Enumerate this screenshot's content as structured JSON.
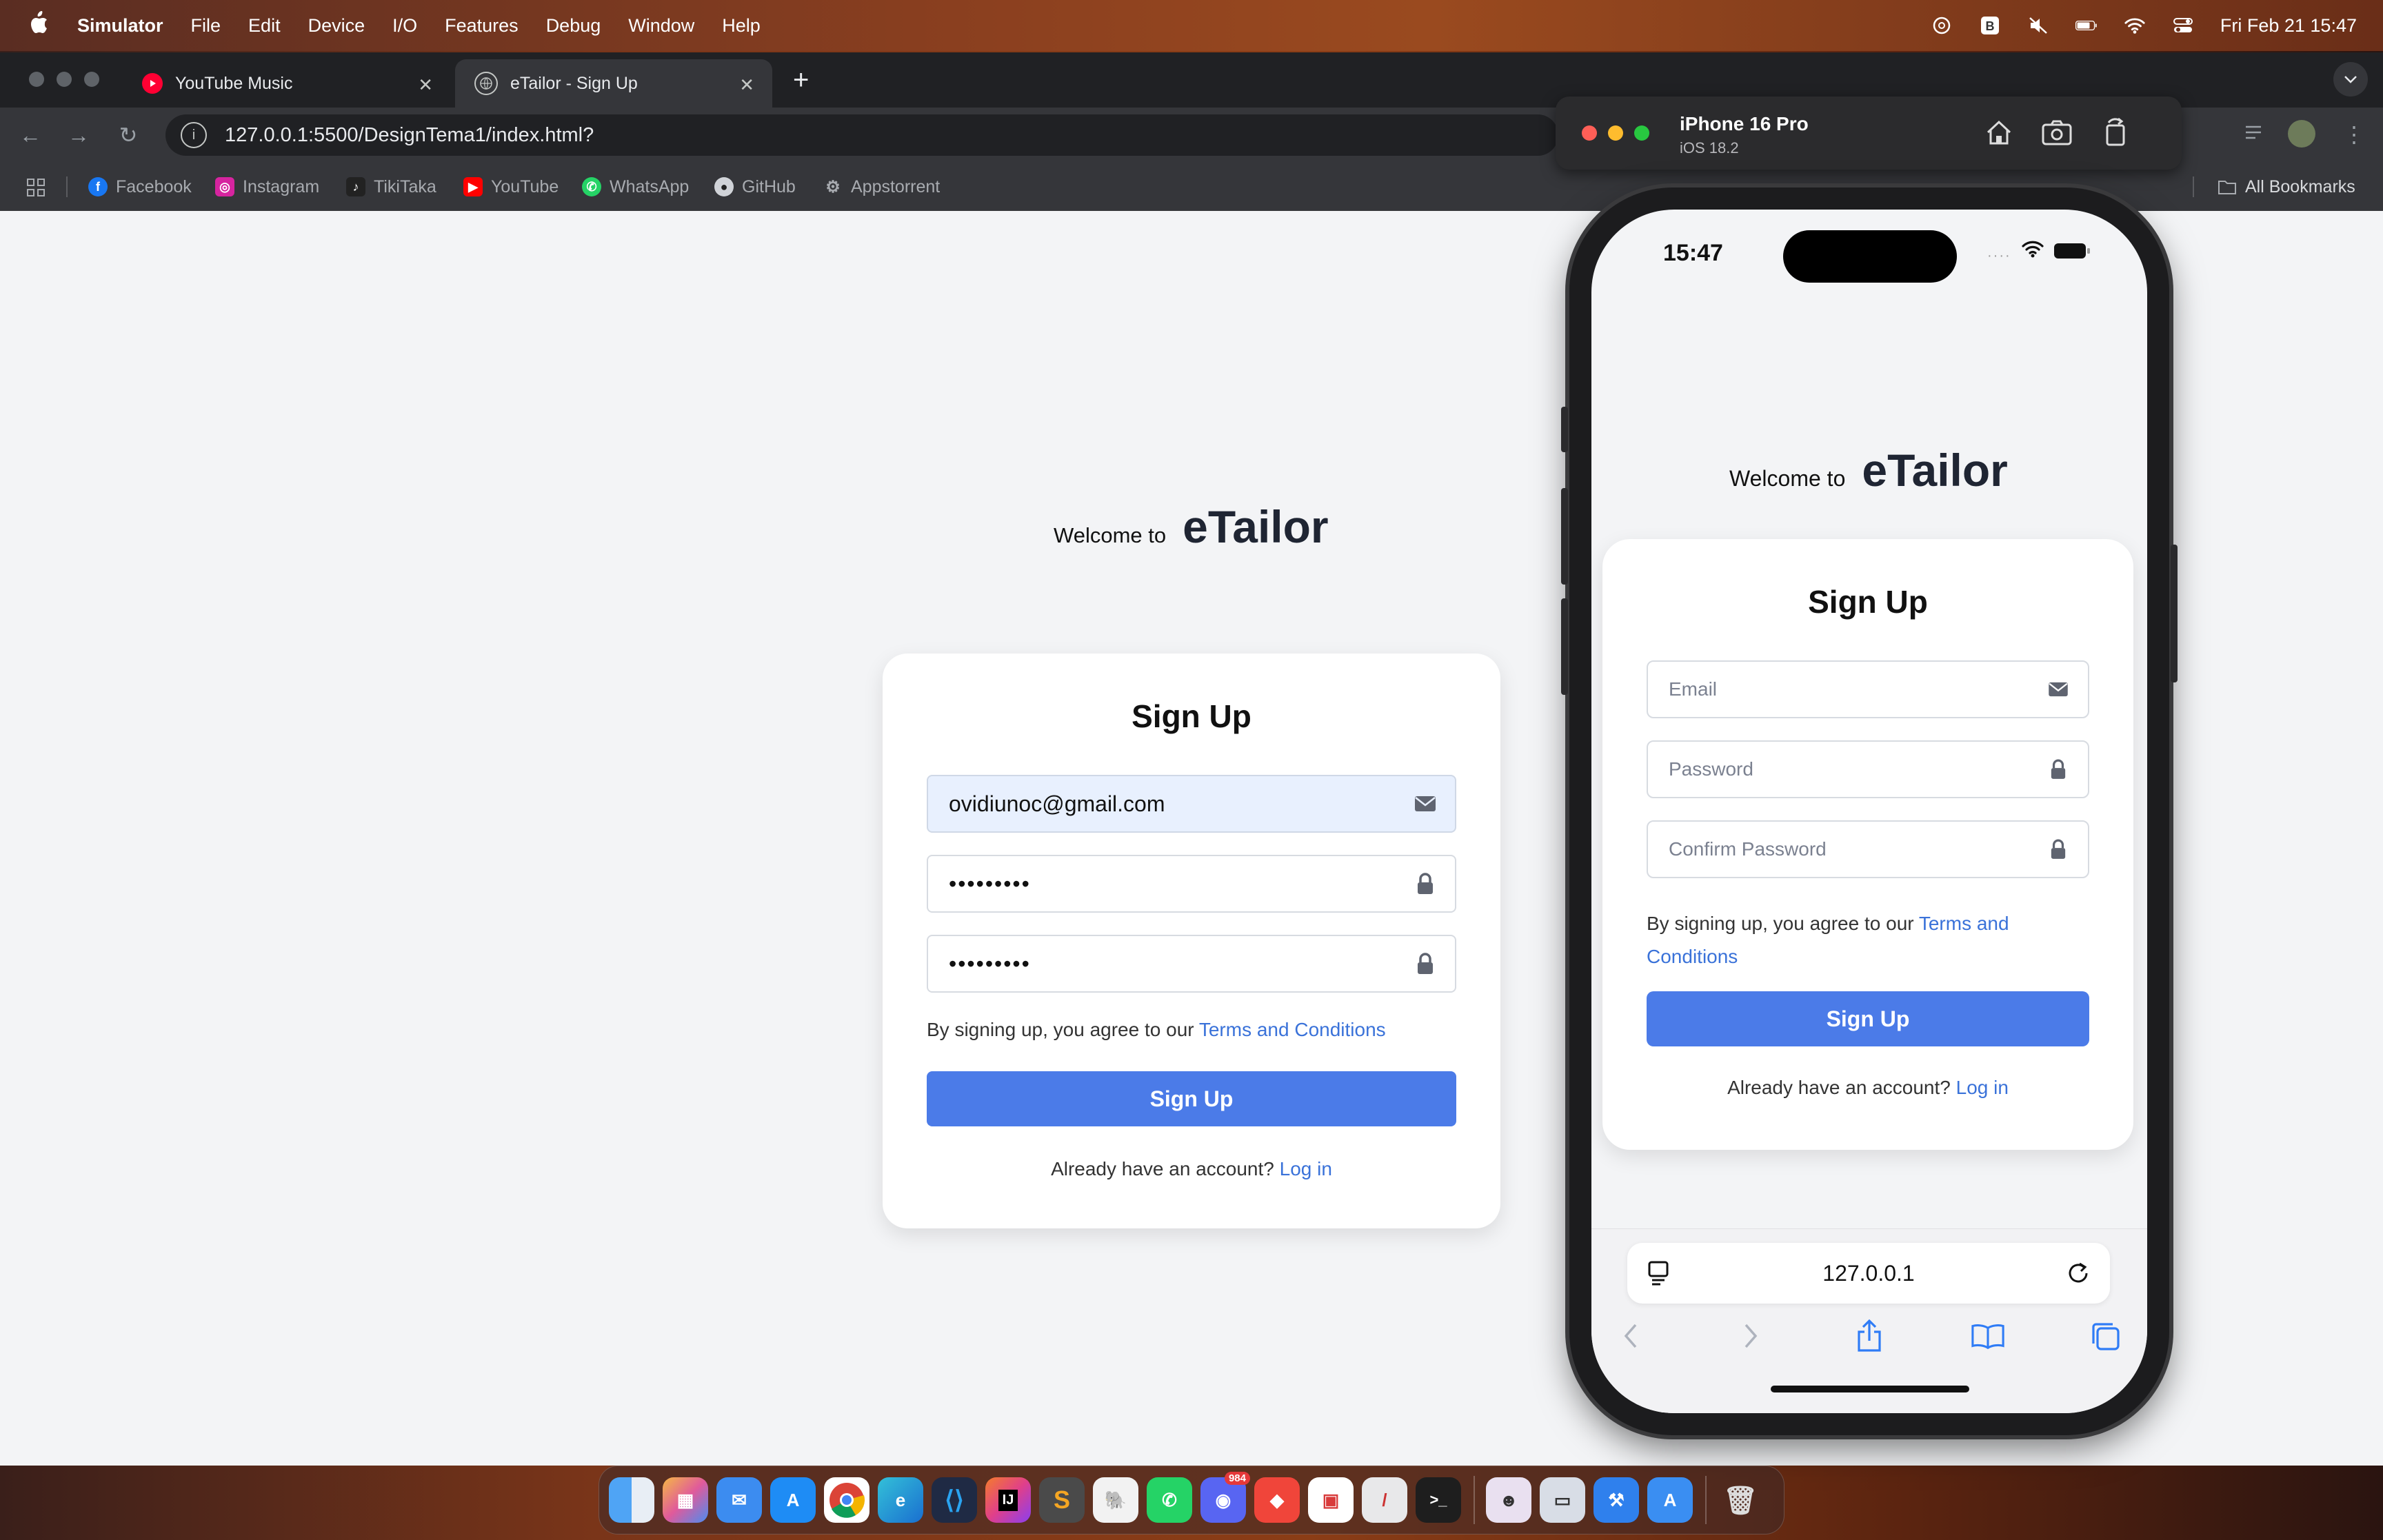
{
  "menubar": {
    "app_name": "Simulator",
    "items": [
      "File",
      "Edit",
      "Device",
      "I/O",
      "Features",
      "Debug",
      "Window",
      "Help"
    ],
    "datetime": "Fri Feb 21  15:47"
  },
  "browser": {
    "tabs": [
      {
        "title": "YouTube Music",
        "active": false
      },
      {
        "title": "eTailor - Sign Up",
        "active": true
      }
    ],
    "new_tab": "+",
    "url": "127.0.0.1:5500/DesignTema1/index.html?",
    "bookmarks": [
      "Facebook",
      "Instagram",
      "TikiTaka",
      "YouTube",
      "WhatsApp",
      "GitHub",
      "Appstorrent"
    ],
    "all_bookmarks": "All Bookmarks"
  },
  "desktop_page": {
    "welcome": "Welcome to",
    "brand": "eTailor",
    "title": "Sign Up",
    "email_value": "ovidiunoc@gmail.com",
    "password_value": "•••••••••",
    "confirm_value": "•••••••••",
    "terms_prefix": "By signing up, you agree to our ",
    "terms_link": "Terms and Conditions",
    "submit": "Sign Up",
    "login_prefix": "Already have an account? ",
    "login_link": "Log in"
  },
  "simulator": {
    "device": "iPhone 16 Pro",
    "os": "iOS 18.2",
    "time": "15:47",
    "url": "127.0.0.1"
  },
  "mobile_page": {
    "welcome": "Welcome to",
    "brand": "eTailor",
    "title": "Sign Up",
    "email_placeholder": "Email",
    "password_placeholder": "Password",
    "confirm_placeholder": "Confirm Password",
    "terms_prefix": "By signing up, you agree to our ",
    "terms_link_1": "Terms and",
    "terms_link_2": "Conditions",
    "submit": "Sign Up",
    "login_prefix": "Already have an account? ",
    "login_link": "Log in"
  },
  "dock": {
    "discord_badge": "984"
  },
  "colors": {
    "primary": "#4b7be8",
    "link": "#3a72d9",
    "autofill": "#e8f0fe"
  }
}
